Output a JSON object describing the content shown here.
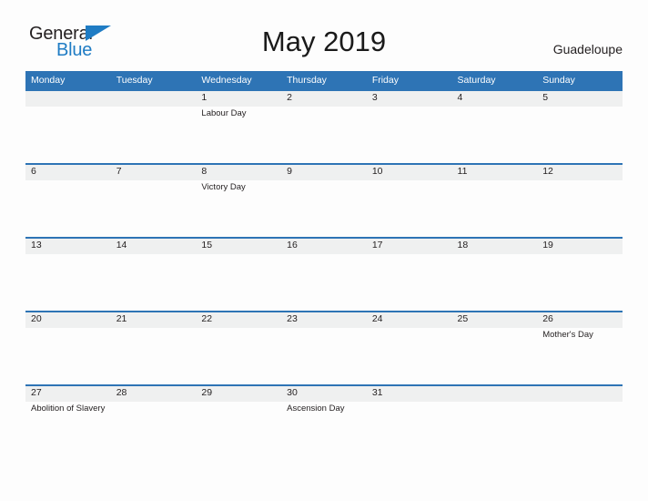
{
  "brand": {
    "name_part1": "General",
    "name_part2": "Blue",
    "flag_icon": "flag-icon"
  },
  "header": {
    "title": "May 2019",
    "region": "Guadeloupe"
  },
  "colors": {
    "header_blue": "#2e74b5",
    "row_line_blue": "#2e74b5",
    "band_gray": "#eff0f0",
    "logo_blue": "#1f7cc4",
    "text": "#231f20"
  },
  "calendar": {
    "weekdays": [
      "Monday",
      "Tuesday",
      "Wednesday",
      "Thursday",
      "Friday",
      "Saturday",
      "Sunday"
    ],
    "weeks": [
      {
        "band_columns": 7,
        "days": [
          {
            "number": "",
            "event": ""
          },
          {
            "number": "",
            "event": ""
          },
          {
            "number": "1",
            "event": "Labour Day"
          },
          {
            "number": "2",
            "event": ""
          },
          {
            "number": "3",
            "event": ""
          },
          {
            "number": "4",
            "event": ""
          },
          {
            "number": "5",
            "event": ""
          }
        ]
      },
      {
        "band_columns": 7,
        "days": [
          {
            "number": "6",
            "event": ""
          },
          {
            "number": "7",
            "event": ""
          },
          {
            "number": "8",
            "event": "Victory Day"
          },
          {
            "number": "9",
            "event": ""
          },
          {
            "number": "10",
            "event": ""
          },
          {
            "number": "11",
            "event": ""
          },
          {
            "number": "12",
            "event": ""
          }
        ]
      },
      {
        "band_columns": 7,
        "days": [
          {
            "number": "13",
            "event": ""
          },
          {
            "number": "14",
            "event": ""
          },
          {
            "number": "15",
            "event": ""
          },
          {
            "number": "16",
            "event": ""
          },
          {
            "number": "17",
            "event": ""
          },
          {
            "number": "18",
            "event": ""
          },
          {
            "number": "19",
            "event": ""
          }
        ]
      },
      {
        "band_columns": 7,
        "days": [
          {
            "number": "20",
            "event": ""
          },
          {
            "number": "21",
            "event": ""
          },
          {
            "number": "22",
            "event": ""
          },
          {
            "number": "23",
            "event": ""
          },
          {
            "number": "24",
            "event": ""
          },
          {
            "number": "25",
            "event": ""
          },
          {
            "number": "26",
            "event": "Mother's Day"
          }
        ]
      },
      {
        "band_columns": 7,
        "days": [
          {
            "number": "27",
            "event": "Abolition of Slavery"
          },
          {
            "number": "28",
            "event": ""
          },
          {
            "number": "29",
            "event": ""
          },
          {
            "number": "30",
            "event": "Ascension Day"
          },
          {
            "number": "31",
            "event": ""
          },
          {
            "number": "",
            "event": ""
          },
          {
            "number": "",
            "event": ""
          }
        ]
      }
    ]
  }
}
